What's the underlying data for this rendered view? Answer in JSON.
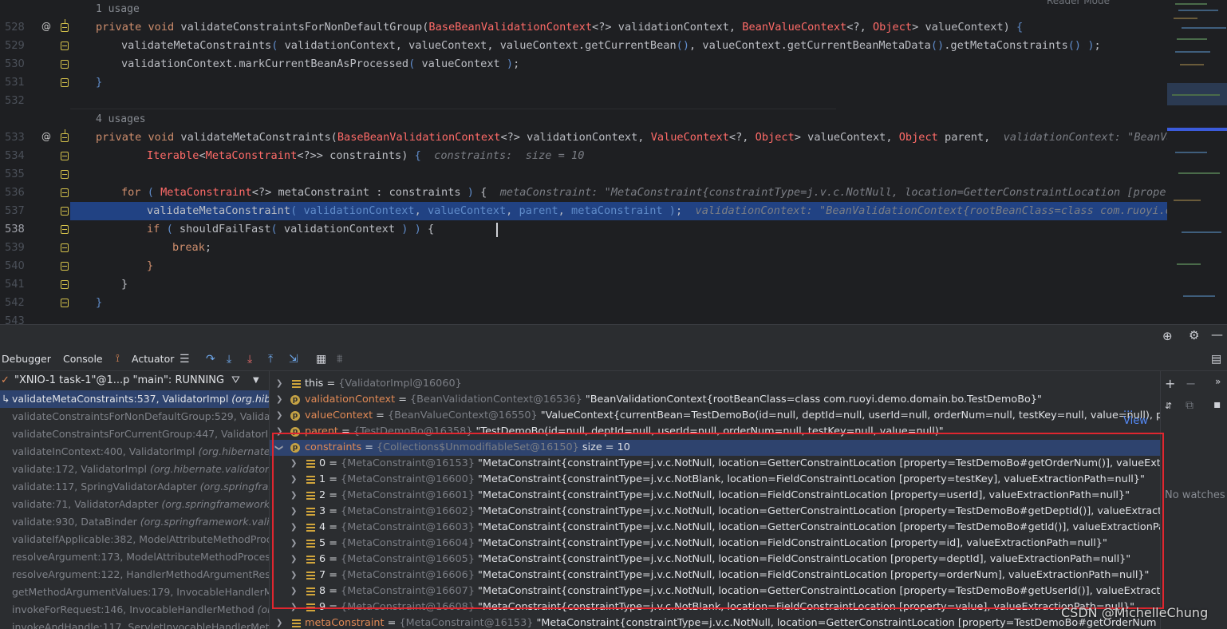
{
  "editor": {
    "reader_mode": "Reader Mode",
    "usages": [
      {
        "text": "1 usage",
        "line_index": 0
      },
      {
        "text": "4 usages",
        "line_index": 5
      }
    ],
    "line_numbers": [
      "528",
      "529",
      "530",
      "531",
      "532",
      "533",
      "534",
      "535",
      "536",
      "537",
      "538",
      "539",
      "540",
      "541",
      "542",
      "543"
    ],
    "current_line": "538",
    "lines": [
      "private void validateConstraintsForNonDefaultGroup(BaseBeanValidationContext<?> validationContext, BeanValueContext<?, Object> valueContext) {",
      "validateMetaConstraints( validationContext, valueContext, valueContext.getCurrentBean(), valueContext.getCurrentBeanMetaData().getMetaConstraints() );",
      "validationContext.markCurrentBeanAsProcessed( valueContext );",
      "}",
      "",
      "private void validateMetaConstraints(BaseBeanValidationContext<?> validationContext, ValueContext<?, Object> valueContext, Object parent,",
      "Iterable<MetaConstraint<?>> constraints) {",
      "",
      "for ( MetaConstraint<?> metaConstraint : constraints ) {",
      "validateMetaConstraint( validationContext, valueContext, parent, metaConstraint );",
      "if ( shouldFailFast( validationContext ) ) {",
      "break;",
      "}",
      "}",
      "}"
    ],
    "hints": {
      "line533": "validationContext: \"BeanValid",
      "line534": "constraints:  size = 10",
      "line536": "metaConstraint: \"MetaConstraint{constraintType=j.v.c.NotNull, location=GetterConstraintLocation [property=",
      "line537": "validationContext: \"BeanValidationContext{rootBeanClass=class com.ruoyi.demo"
    }
  },
  "debug": {
    "tabs": {
      "debugger": "Debugger",
      "console": "Console",
      "actuator": "Actuator"
    },
    "thread": "\"XNIO-1 task-1\"@1...p \"main\": RUNNING",
    "frames": [
      {
        "method": "validateMetaConstraints:537, ValidatorImpl",
        "cls": "(org.hibe",
        "selected": true
      },
      {
        "method": "validateConstraintsForNonDefaultGroup:529, Validat",
        "cls": "",
        "selected": false
      },
      {
        "method": "validateConstraintsForCurrentGroup:447, ValidatorIm",
        "cls": "",
        "selected": false
      },
      {
        "method": "validateInContext:400, ValidatorImpl",
        "cls": "(org.hibernate.v",
        "selected": false
      },
      {
        "method": "validate:172, ValidatorImpl",
        "cls": "(org.hibernate.validator.in",
        "selected": false
      },
      {
        "method": "validate:117, SpringValidatorAdapter",
        "cls": "(org.springfram",
        "selected": false
      },
      {
        "method": "validate:71, ValidatorAdapter",
        "cls": "(org.springframework.b",
        "selected": false
      },
      {
        "method": "validate:930, DataBinder",
        "cls": "(org.springframework.valida",
        "selected": false
      },
      {
        "method": "validateIfApplicable:382, ModelAttributeMethodProc",
        "cls": "",
        "selected": false
      },
      {
        "method": "resolveArgument:173, ModelAttributeMethodProces",
        "cls": "",
        "selected": false
      },
      {
        "method": "resolveArgument:122, HandlerMethodArgumentReso",
        "cls": "",
        "selected": false
      },
      {
        "method": "getMethodArgumentValues:179, InvocableHandlerM",
        "cls": "",
        "selected": false
      },
      {
        "method": "invokeForRequest:146, InvocableHandlerMethod",
        "cls": "(or",
        "selected": false
      },
      {
        "method": "invokeAndHandle:117, ServletInvocableHandlerMeth",
        "cls": "",
        "selected": false
      }
    ],
    "variables": {
      "this": {
        "name": "this",
        "ref": "{ValidatorImpl@16060}",
        "value": ""
      },
      "validationContext": {
        "name": "validationContext",
        "ref": "{BeanValidationContext@16536}",
        "value": "\"BeanValidationContext{rootBeanClass=class com.ruoyi.demo.domain.bo.TestDemoBo}\""
      },
      "valueContext": {
        "name": "valueContext",
        "ref": "{BeanValueContext@16550}",
        "value": "\"ValueContext{currentBean=TestDemoBo(id=null, deptId=null, userId=null, orderNum=null, testKey=null, value=null), prop"
      },
      "parent": {
        "name": "parent",
        "ref": "{TestDemoBo@16358}",
        "value": "\"TestDemoBo(id=null, deptId=null, userId=null, orderNum=null, testKey=null, value=null)\""
      },
      "constraints": {
        "name": "constraints",
        "ref": "{Collections$UnmodifiableSet@16150}",
        "value": "size = 10"
      },
      "items": [
        {
          "idx": "0",
          "ref": "{MetaConstraint@16153}",
          "value": "\"MetaConstraint{constraintType=j.v.c.NotNull, location=GetterConstraintLocation [property=TestDemoBo#getOrderNum()], valueExtractionP"
        },
        {
          "idx": "1",
          "ref": "{MetaConstraint@16600}",
          "value": "\"MetaConstraint{constraintType=j.v.c.NotBlank, location=FieldConstraintLocation [property=testKey], valueExtractionPath=null}\""
        },
        {
          "idx": "2",
          "ref": "{MetaConstraint@16601}",
          "value": "\"MetaConstraint{constraintType=j.v.c.NotNull, location=FieldConstraintLocation [property=userId], valueExtractionPath=null}\""
        },
        {
          "idx": "3",
          "ref": "{MetaConstraint@16602}",
          "value": "\"MetaConstraint{constraintType=j.v.c.NotNull, location=GetterConstraintLocation [property=TestDemoBo#getDeptId()], valueExtractionPath"
        },
        {
          "idx": "4",
          "ref": "{MetaConstraint@16603}",
          "value": "\"MetaConstraint{constraintType=j.v.c.NotNull, location=GetterConstraintLocation [property=TestDemoBo#getId()], valueExtractionPath=null"
        },
        {
          "idx": "5",
          "ref": "{MetaConstraint@16604}",
          "value": "\"MetaConstraint{constraintType=j.v.c.NotNull, location=FieldConstraintLocation [property=id], valueExtractionPath=null}\""
        },
        {
          "idx": "6",
          "ref": "{MetaConstraint@16605}",
          "value": "\"MetaConstraint{constraintType=j.v.c.NotNull, location=FieldConstraintLocation [property=deptId], valueExtractionPath=null}\""
        },
        {
          "idx": "7",
          "ref": "{MetaConstraint@16606}",
          "value": "\"MetaConstraint{constraintType=j.v.c.NotNull, location=FieldConstraintLocation [property=orderNum], valueExtractionPath=null}\""
        },
        {
          "idx": "8",
          "ref": "{MetaConstraint@16607}",
          "value": "\"MetaConstraint{constraintType=j.v.c.NotNull, location=GetterConstraintLocation [property=TestDemoBo#getUserId()], valueExtractionPath="
        },
        {
          "idx": "9",
          "ref": "{MetaConstraint@16608}",
          "value": "\"MetaConstraint{constraintType=j.v.c.NotBlank, location=FieldConstraintLocation [property=value], valueExtractionPath=null}\""
        }
      ],
      "metaConstraint": {
        "name": "metaConstraint",
        "ref": "{MetaConstraint@16153}",
        "value": "\"MetaConstraint{constraintType=j.v.c.NotNull, location=GetterConstraintLocation [property=TestDemoBo#getOrderNum"
      }
    },
    "view_link": "... View",
    "no_watches": "No watches"
  },
  "watermark": "CSDN @MichelleChung",
  "colors": {
    "highlight_line": "#214283",
    "selection_row": "#2e436e",
    "annotation_box": "#e0262f"
  }
}
